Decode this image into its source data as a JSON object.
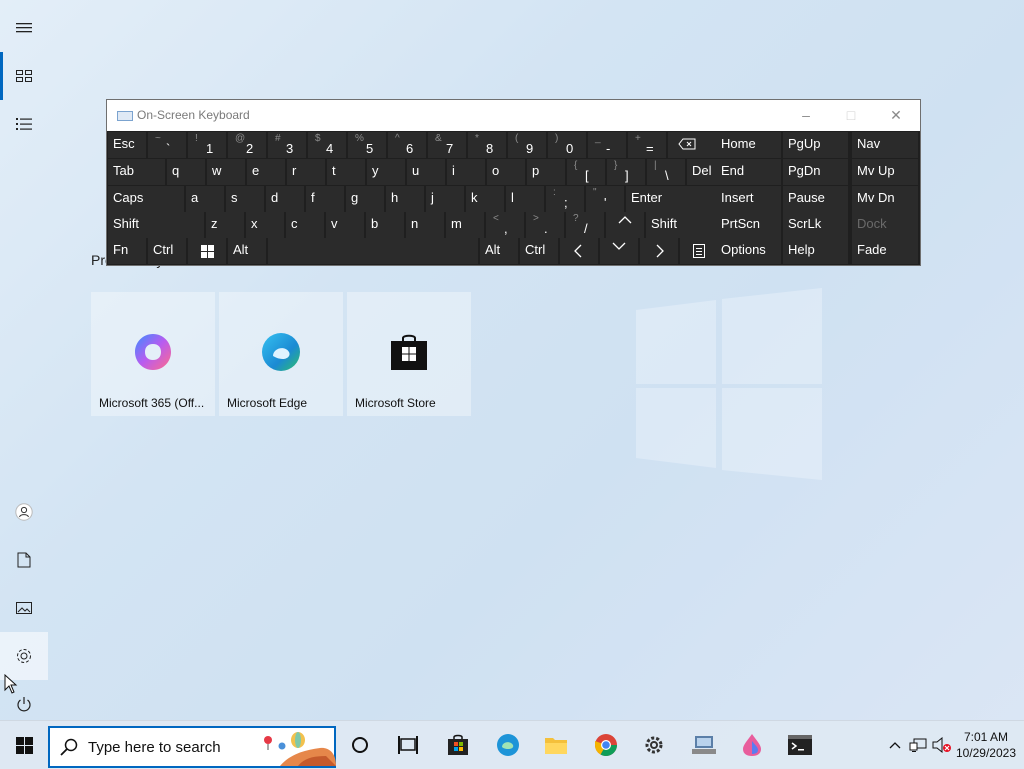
{
  "start": {
    "group_title": "Productivity",
    "tiles": [
      {
        "label": "Microsoft 365 (Off..."
      },
      {
        "label": "Microsoft Edge"
      },
      {
        "label": "Microsoft Store"
      }
    ]
  },
  "rail": {
    "items": [
      "menu-icon",
      "all-tiles-icon",
      "list-icon",
      "user-icon",
      "documents-icon",
      "pictures-icon",
      "settings-icon",
      "power-icon"
    ]
  },
  "osk": {
    "title": "On-Screen Keyboard",
    "rows": [
      [
        {
          "m": "Esc"
        },
        {
          "s": "~",
          "c": "`"
        },
        {
          "s": "!",
          "c": "1"
        },
        {
          "s": "@",
          "c": "2"
        },
        {
          "s": "#",
          "c": "3"
        },
        {
          "s": "$",
          "c": "4"
        },
        {
          "s": "%",
          "c": "5"
        },
        {
          "s": "^",
          "c": "6"
        },
        {
          "s": "&",
          "c": "7"
        },
        {
          "s": "*",
          "c": "8"
        },
        {
          "s": "(",
          "c": "9"
        },
        {
          "s": ")",
          "c": "0"
        },
        {
          "s": "_",
          "c": "-"
        },
        {
          "s": "+",
          "c": "="
        },
        {
          "icon": "backspace"
        }
      ],
      [
        {
          "m": "Tab"
        },
        {
          "m": "q"
        },
        {
          "m": "w"
        },
        {
          "m": "e"
        },
        {
          "m": "r"
        },
        {
          "m": "t"
        },
        {
          "m": "y"
        },
        {
          "m": "u"
        },
        {
          "m": "i"
        },
        {
          "m": "o"
        },
        {
          "m": "p"
        },
        {
          "s": "{",
          "c": "["
        },
        {
          "s": "}",
          "c": "]"
        },
        {
          "s": "|",
          "c": "\\"
        },
        {
          "m": "Del"
        }
      ],
      [
        {
          "m": "Caps"
        },
        {
          "m": "a"
        },
        {
          "m": "s"
        },
        {
          "m": "d"
        },
        {
          "m": "f"
        },
        {
          "m": "g"
        },
        {
          "m": "h"
        },
        {
          "m": "j"
        },
        {
          "m": "k"
        },
        {
          "m": "l"
        },
        {
          "s": ":",
          "c": ";"
        },
        {
          "s": "\"",
          "c": "'"
        },
        {
          "m": "Enter"
        }
      ],
      [
        {
          "m": "Shift"
        },
        {
          "m": "z"
        },
        {
          "m": "x"
        },
        {
          "m": "c"
        },
        {
          "m": "v"
        },
        {
          "m": "b"
        },
        {
          "m": "n"
        },
        {
          "m": "m"
        },
        {
          "s": "<",
          "c": ","
        },
        {
          "s": ">",
          "c": "."
        },
        {
          "s": "?",
          "c": "/"
        },
        {
          "icon": "up"
        },
        {
          "m": "Shift"
        }
      ],
      [
        {
          "m": "Fn"
        },
        {
          "m": "Ctrl"
        },
        {
          "icon": "win"
        },
        {
          "m": "Alt"
        },
        {
          "m": ""
        },
        {
          "m": "Alt"
        },
        {
          "m": "Ctrl"
        },
        {
          "icon": "left"
        },
        {
          "icon": "down"
        },
        {
          "icon": "right"
        },
        {
          "icon": "menu"
        }
      ]
    ],
    "nav": [
      [
        "Home",
        "PgUp",
        "Nav"
      ],
      [
        "End",
        "PgDn",
        "Mv Up"
      ],
      [
        "Insert",
        "Pause",
        "Mv Dn"
      ],
      [
        "PrtScn",
        "ScrLk",
        "Dock"
      ],
      [
        "Options",
        "Help",
        "Fade"
      ]
    ]
  },
  "taskbar": {
    "search_placeholder": "Type here to search",
    "apps": [
      "cortana-icon",
      "task-view-icon",
      "store-icon",
      "edge-icon",
      "file-explorer-icon",
      "chrome-icon",
      "settings-icon",
      "network-app-icon",
      "paint-icon",
      "terminal-icon"
    ],
    "time": "7:01 AM",
    "date": "10/29/2023"
  }
}
